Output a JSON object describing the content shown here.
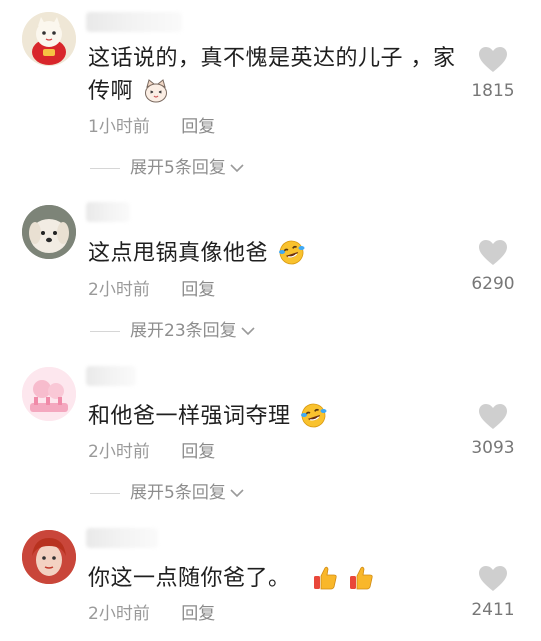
{
  "comments": [
    {
      "text": "这话说的，真不愧是英达的儿子 ，家传啊",
      "time": "1小时前",
      "reply_label": "回复",
      "likes": "1815",
      "expand_label": "展开5条回复",
      "emojis": [
        "cat-face-icon"
      ]
    },
    {
      "text": "这点甩锅真像他爸",
      "time": "2小时前",
      "reply_label": "回复",
      "likes": "6290",
      "expand_label": "展开23条回复",
      "emojis": [
        "laughing-tears-icon"
      ]
    },
    {
      "text": "和他爸一样强词夺理",
      "time": "2小时前",
      "reply_label": "回复",
      "likes": "3093",
      "expand_label": "展开5条回复",
      "emojis": [
        "laughing-tears-icon"
      ]
    },
    {
      "text": "你这一点随你爸了。",
      "time": "2小时前",
      "reply_label": "回复",
      "likes": "2411",
      "expand_label": "",
      "emojis": [
        "thumbs-up-icon",
        "thumbs-up-icon"
      ]
    }
  ],
  "colors": {
    "text": "#1f1f1f",
    "meta": "#9a9a9a",
    "like_icon": "#cfcfcf",
    "emoji_yellow": "#f9c22e"
  }
}
